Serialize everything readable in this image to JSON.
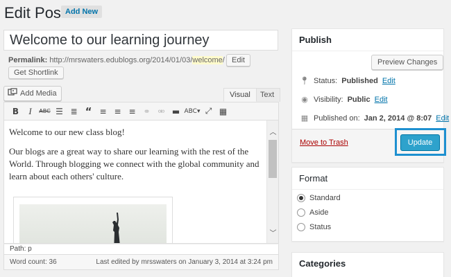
{
  "header": {
    "title": "Edit Post",
    "add_new": "Add New"
  },
  "post": {
    "title": "Welcome to our learning journey"
  },
  "permalink": {
    "label": "Permalink:",
    "base": "http://mrswaters.edublogs.org/2014/01/03/",
    "slug": "welcome",
    "trail": "/",
    "edit": "Edit",
    "shortlink": "Get Shortlink"
  },
  "editor": {
    "add_media": "Add Media",
    "tabs": {
      "visual": "Visual",
      "text": "Text"
    },
    "toolbar": [
      "bold-icon",
      "italic-icon",
      "strikethrough-icon",
      "bullet-list-icon",
      "numbered-list-icon",
      "blockquote-icon",
      "align-left-icon",
      "align-center-icon",
      "align-right-icon",
      "insert-link-icon",
      "unlink-icon",
      "read-more-icon",
      "spellcheck-icon",
      "fullscreen-icon",
      "kitchen-sink-icon"
    ],
    "paragraphs": [
      "Welcome to our new class blog!",
      "Our blogs are a great way to share our learning with the rest of the World. Through blogging we connect with the global community and learn about each others' culture."
    ],
    "path": "Path: p",
    "word_count": "Word count: 36",
    "last_edited": "Last edited by mrsswaters on January 3, 2014 at 3:24 pm"
  },
  "publish": {
    "title": "Publish",
    "preview": "Preview Changes",
    "status_label": "Status:",
    "status_value": "Published",
    "status_edit": "Edit",
    "visibility_label": "Visibility:",
    "visibility_value": "Public",
    "visibility_edit": "Edit",
    "published_label": "Published on:",
    "published_value": "Jan 2, 2014 @ 8:07",
    "published_edit": "Edit",
    "trash": "Move to Trash",
    "update": "Update"
  },
  "format": {
    "title": "Format",
    "options": [
      "Standard",
      "Aside",
      "Status"
    ],
    "selected": "Standard"
  },
  "categories": {
    "title": "Categories"
  },
  "colors": {
    "accent": "#0073aa",
    "update_button": "#2ea2cc",
    "highlight": "#1e90d0",
    "trash": "#a00"
  }
}
